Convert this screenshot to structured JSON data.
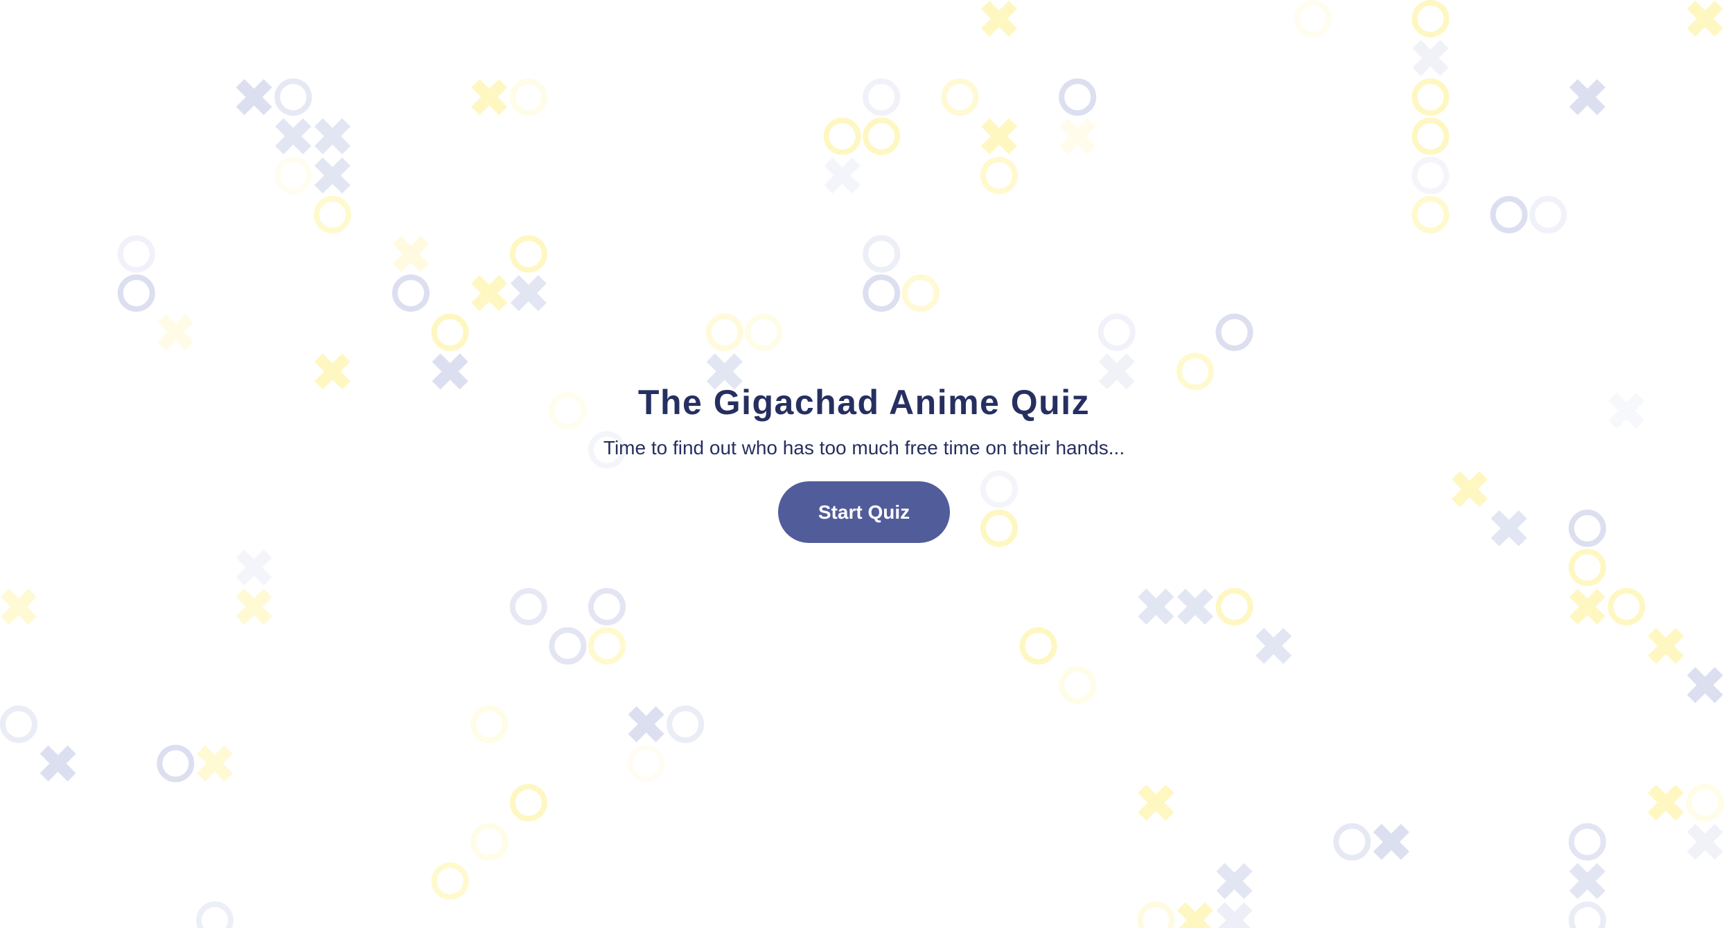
{
  "hero": {
    "title": "The Gigachad Anime Quiz",
    "subtitle": "Time to find out who has too much free time on their hands...",
    "start_button": "Start Quiz"
  },
  "colors": {
    "text": "#262f60",
    "button": "#515c9a",
    "pattern_blue": "#dcdff0",
    "pattern_yellow": "#fff7c2"
  },
  "background": {
    "pattern": "tic-tac-toe x and o marks"
  }
}
